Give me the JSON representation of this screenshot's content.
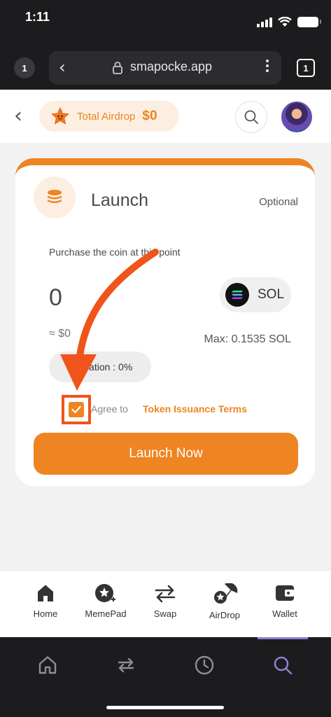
{
  "status_bar": {
    "time": "1:11"
  },
  "browser": {
    "tab_badge": "1",
    "url": "smapocke.app",
    "tabs_count": "1"
  },
  "header": {
    "airdrop_label": "Total Airdrop",
    "airdrop_value": "$0"
  },
  "card": {
    "title": "Launch",
    "optional": "Optional",
    "purchase_text": "Purchase the coin at this point",
    "amount": "0",
    "token": "SOL",
    "usd_value": "≈ $0",
    "max_value": "Max: 0.1535 SOL",
    "allocation": "Allocation : 0%",
    "agree_text": "Agree to",
    "terms_link": "Token Issuance Terms",
    "checkbox_checked": true,
    "launch_button": "Launch Now"
  },
  "app_nav": {
    "items": [
      {
        "label": "Home",
        "icon": "home-icon"
      },
      {
        "label": "MemePad",
        "icon": "memepad-icon"
      },
      {
        "label": "Swap",
        "icon": "swap-icon"
      },
      {
        "label": "AirDrop",
        "icon": "airdrop-icon"
      },
      {
        "label": "Wallet",
        "icon": "wallet-icon"
      }
    ]
  },
  "browser_bottom": {
    "items": [
      "home-icon",
      "swap-icon",
      "history-icon",
      "search-icon"
    ],
    "active_color": "#8b7fd4"
  },
  "colors": {
    "accent": "#ee8422",
    "annotation": "#f0541a"
  }
}
